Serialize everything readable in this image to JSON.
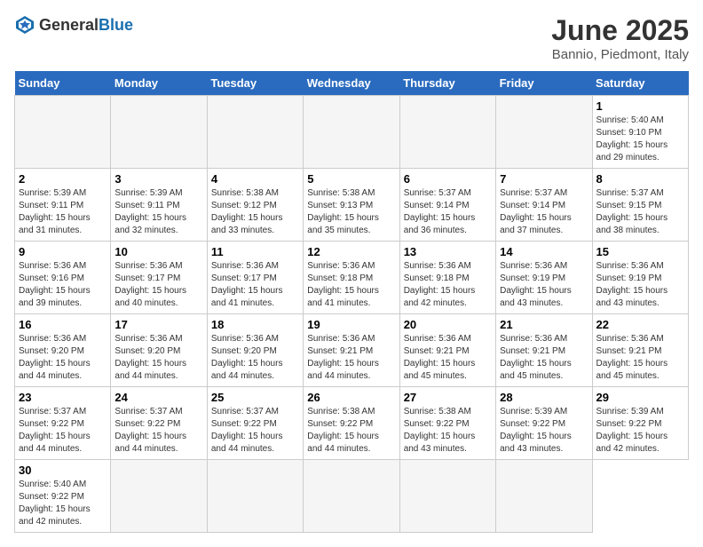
{
  "header": {
    "logo_general": "General",
    "logo_blue": "Blue",
    "month_title": "June 2025",
    "location": "Bannio, Piedmont, Italy"
  },
  "weekdays": [
    "Sunday",
    "Monday",
    "Tuesday",
    "Wednesday",
    "Thursday",
    "Friday",
    "Saturday"
  ],
  "days": [
    {
      "num": "",
      "empty": true
    },
    {
      "num": "",
      "empty": true
    },
    {
      "num": "",
      "empty": true
    },
    {
      "num": "",
      "empty": true
    },
    {
      "num": "",
      "empty": true
    },
    {
      "num": "",
      "empty": true
    },
    {
      "num": "1",
      "sunrise": "5:40 AM",
      "sunset": "9:10 PM",
      "daylight": "15 hours and 29 minutes."
    },
    {
      "num": "2",
      "sunrise": "5:39 AM",
      "sunset": "9:11 PM",
      "daylight": "15 hours and 31 minutes."
    },
    {
      "num": "3",
      "sunrise": "5:39 AM",
      "sunset": "9:11 PM",
      "daylight": "15 hours and 32 minutes."
    },
    {
      "num": "4",
      "sunrise": "5:38 AM",
      "sunset": "9:12 PM",
      "daylight": "15 hours and 33 minutes."
    },
    {
      "num": "5",
      "sunrise": "5:38 AM",
      "sunset": "9:13 PM",
      "daylight": "15 hours and 35 minutes."
    },
    {
      "num": "6",
      "sunrise": "5:37 AM",
      "sunset": "9:14 PM",
      "daylight": "15 hours and 36 minutes."
    },
    {
      "num": "7",
      "sunrise": "5:37 AM",
      "sunset": "9:14 PM",
      "daylight": "15 hours and 37 minutes."
    },
    {
      "num": "8",
      "sunrise": "5:37 AM",
      "sunset": "9:15 PM",
      "daylight": "15 hours and 38 minutes."
    },
    {
      "num": "9",
      "sunrise": "5:36 AM",
      "sunset": "9:16 PM",
      "daylight": "15 hours and 39 minutes."
    },
    {
      "num": "10",
      "sunrise": "5:36 AM",
      "sunset": "9:17 PM",
      "daylight": "15 hours and 40 minutes."
    },
    {
      "num": "11",
      "sunrise": "5:36 AM",
      "sunset": "9:17 PM",
      "daylight": "15 hours and 41 minutes."
    },
    {
      "num": "12",
      "sunrise": "5:36 AM",
      "sunset": "9:18 PM",
      "daylight": "15 hours and 41 minutes."
    },
    {
      "num": "13",
      "sunrise": "5:36 AM",
      "sunset": "9:18 PM",
      "daylight": "15 hours and 42 minutes."
    },
    {
      "num": "14",
      "sunrise": "5:36 AM",
      "sunset": "9:19 PM",
      "daylight": "15 hours and 43 minutes."
    },
    {
      "num": "15",
      "sunrise": "5:36 AM",
      "sunset": "9:19 PM",
      "daylight": "15 hours and 43 minutes."
    },
    {
      "num": "16",
      "sunrise": "5:36 AM",
      "sunset": "9:20 PM",
      "daylight": "15 hours and 44 minutes."
    },
    {
      "num": "17",
      "sunrise": "5:36 AM",
      "sunset": "9:20 PM",
      "daylight": "15 hours and 44 minutes."
    },
    {
      "num": "18",
      "sunrise": "5:36 AM",
      "sunset": "9:20 PM",
      "daylight": "15 hours and 44 minutes."
    },
    {
      "num": "19",
      "sunrise": "5:36 AM",
      "sunset": "9:21 PM",
      "daylight": "15 hours and 44 minutes."
    },
    {
      "num": "20",
      "sunrise": "5:36 AM",
      "sunset": "9:21 PM",
      "daylight": "15 hours and 45 minutes."
    },
    {
      "num": "21",
      "sunrise": "5:36 AM",
      "sunset": "9:21 PM",
      "daylight": "15 hours and 45 minutes."
    },
    {
      "num": "22",
      "sunrise": "5:36 AM",
      "sunset": "9:21 PM",
      "daylight": "15 hours and 45 minutes."
    },
    {
      "num": "23",
      "sunrise": "5:37 AM",
      "sunset": "9:22 PM",
      "daylight": "15 hours and 44 minutes."
    },
    {
      "num": "24",
      "sunrise": "5:37 AM",
      "sunset": "9:22 PM",
      "daylight": "15 hours and 44 minutes."
    },
    {
      "num": "25",
      "sunrise": "5:37 AM",
      "sunset": "9:22 PM",
      "daylight": "15 hours and 44 minutes."
    },
    {
      "num": "26",
      "sunrise": "5:38 AM",
      "sunset": "9:22 PM",
      "daylight": "15 hours and 44 minutes."
    },
    {
      "num": "27",
      "sunrise": "5:38 AM",
      "sunset": "9:22 PM",
      "daylight": "15 hours and 43 minutes."
    },
    {
      "num": "28",
      "sunrise": "5:39 AM",
      "sunset": "9:22 PM",
      "daylight": "15 hours and 43 minutes."
    },
    {
      "num": "29",
      "sunrise": "5:39 AM",
      "sunset": "9:22 PM",
      "daylight": "15 hours and 42 minutes."
    },
    {
      "num": "30",
      "sunrise": "5:40 AM",
      "sunset": "9:22 PM",
      "daylight": "15 hours and 42 minutes."
    },
    {
      "num": "",
      "empty": true
    },
    {
      "num": "",
      "empty": true
    },
    {
      "num": "",
      "empty": true
    },
    {
      "num": "",
      "empty": true
    },
    {
      "num": "",
      "empty": true
    }
  ]
}
